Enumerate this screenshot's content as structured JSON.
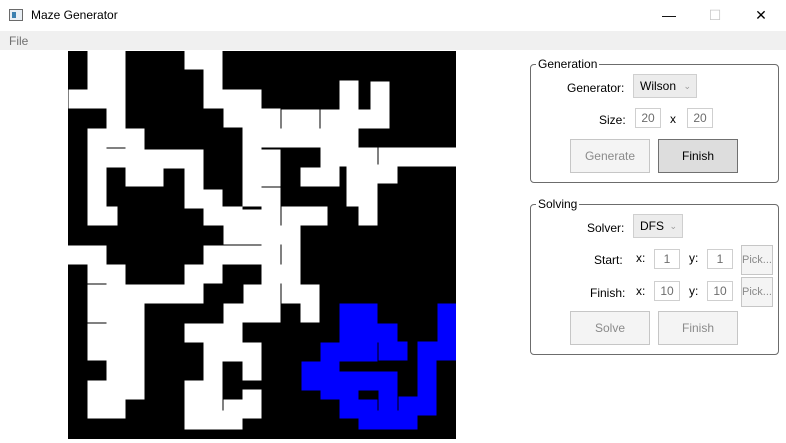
{
  "window": {
    "title": "Maze Generator",
    "minimize": "—",
    "maximize": "☐",
    "close": "✕"
  },
  "menu": {
    "file": "File"
  },
  "maze": {
    "wall_color": "#000000",
    "path_color": "#ffffff",
    "solution_color": "#0000ff"
  },
  "generation": {
    "title": "Generation",
    "generator_label": "Generator:",
    "generator_value": "Wilson",
    "size_label": "Size:",
    "width": "20",
    "x_sep": "x",
    "height": "20",
    "generate_label": "Generate",
    "finish_label": "Finish"
  },
  "solving": {
    "title": "Solving",
    "solver_label": "Solver:",
    "solver_value": "DFS",
    "start_label": "Start:",
    "start_x_label": "x:",
    "start_x": "1",
    "start_y_label": "y:",
    "start_y": "1",
    "start_pick": "Pick...",
    "finish_label": "Finish:",
    "finish_x_label": "x:",
    "finish_x": "10",
    "finish_y_label": "y:",
    "finish_y": "10",
    "finish_pick": "Pick...",
    "solve_label": "Solve",
    "finish_button_label": "Finish"
  }
}
